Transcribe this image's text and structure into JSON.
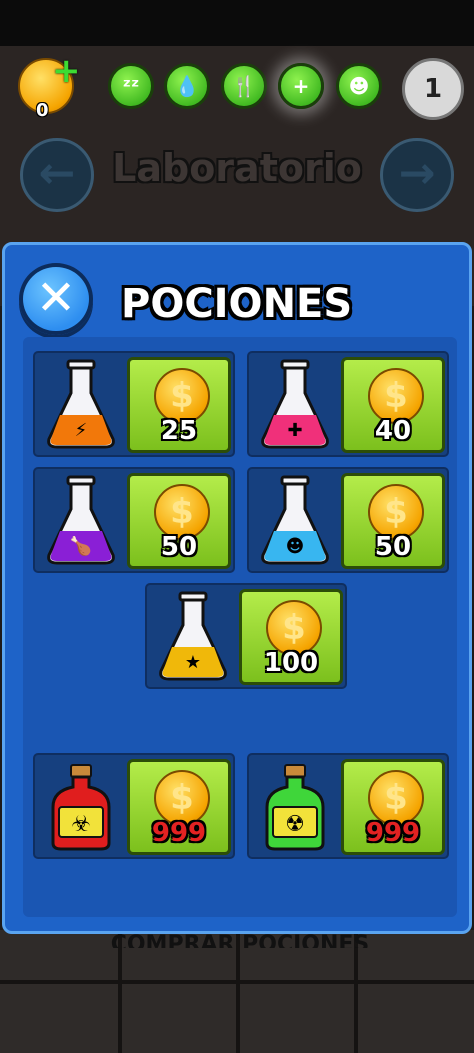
{
  "hud": {
    "coins": "0",
    "coin_add_icon": "plus-icon",
    "stats": [
      {
        "name": "sleep",
        "glyph": "ᶻᶻ",
        "icon": "zzz-icon"
      },
      {
        "name": "water",
        "glyph": "💧",
        "icon": "drop-icon"
      },
      {
        "name": "food",
        "glyph": "🍴",
        "icon": "fork-knife-icon"
      },
      {
        "name": "health",
        "glyph": "+",
        "icon": "health-plus-icon"
      },
      {
        "name": "mood",
        "glyph": "☻",
        "icon": "smile-icon"
      }
    ],
    "level": "1"
  },
  "scene": {
    "room_title": "Laboratorio",
    "prev_glyph": "←",
    "next_glyph": "→",
    "bottom_text": "COMPRAR POCIONES"
  },
  "modal": {
    "title": "POCIONES",
    "close_glyph": "✕",
    "currency_glyph": "$",
    "items": [
      {
        "name": "energy",
        "potion_color": "#f2780a",
        "symbol": "⚡",
        "price": "25",
        "price_color": "white"
      },
      {
        "name": "health",
        "potion_color": "#f0307a",
        "symbol": "✚",
        "price": "40",
        "price_color": "white"
      },
      {
        "name": "food",
        "potion_color": "#8a1fd6",
        "symbol": "🍗",
        "price": "50",
        "price_color": "white"
      },
      {
        "name": "happy",
        "potion_color": "#38b6f0",
        "symbol": "☻",
        "price": "50",
        "price_color": "white"
      },
      {
        "name": "star",
        "potion_color": "#f0b80a",
        "symbol": "★",
        "price": "100",
        "price_color": "white"
      },
      {
        "name": "biohazard",
        "potion_color": "#e01e1e",
        "symbol": "☣",
        "price": "999",
        "price_color": "red"
      },
      {
        "name": "radioactive",
        "potion_color": "#3fd63a",
        "symbol": "☢",
        "price": "999",
        "price_color": "red"
      }
    ]
  }
}
